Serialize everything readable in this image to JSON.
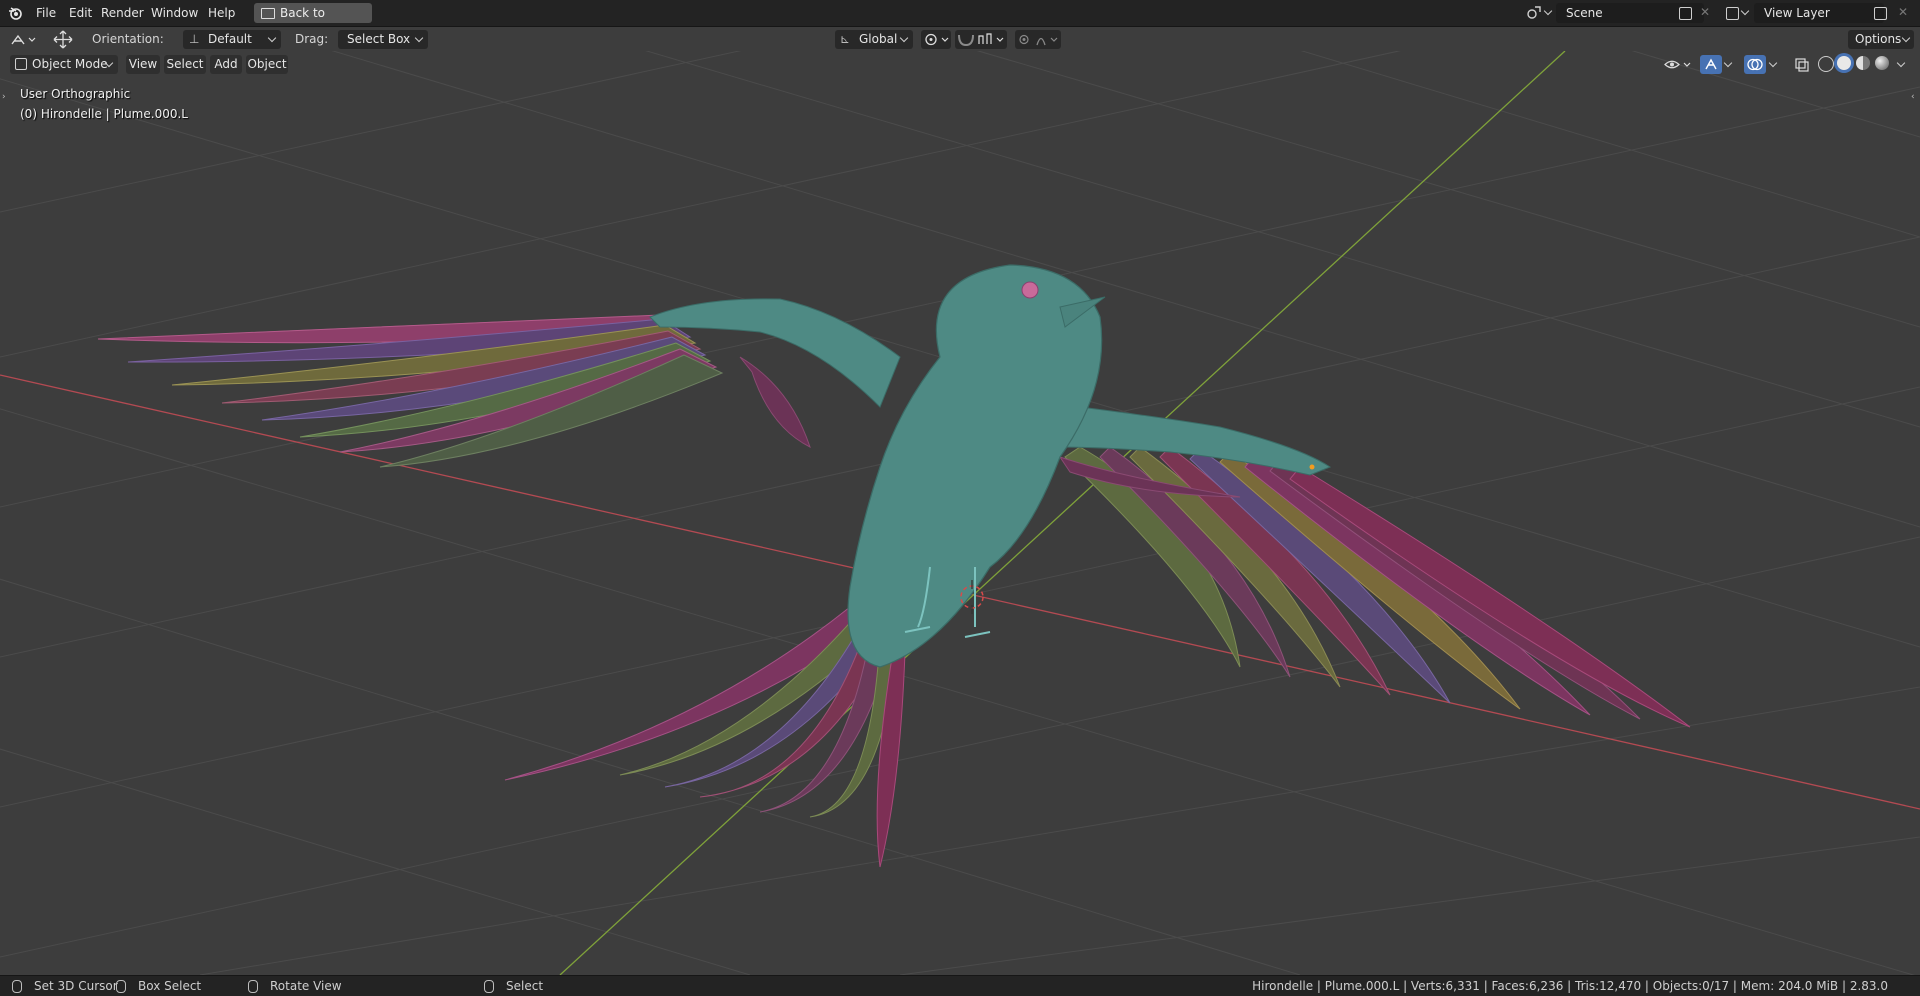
{
  "topbar": {
    "menus": [
      "File",
      "Edit",
      "Render",
      "Window",
      "Help"
    ],
    "back_label": "Back to Previous",
    "scene_name": "Scene",
    "view_layer_name": "View Layer"
  },
  "toolbar": {
    "orientation_label": "Orientation:",
    "orientation_value": "Default",
    "drag_label": "Drag:",
    "drag_value": "Select Box",
    "transform_orientation": "Global",
    "options_label": "Options"
  },
  "header": {
    "mode": "Object Mode",
    "menus": [
      "View",
      "Select",
      "Add",
      "Object"
    ]
  },
  "viewport": {
    "view_name": "User Orthographic",
    "object_info": "(0) Hirondelle | Plume.000.L",
    "colors": {
      "background": "#3d3d3d",
      "grid": "#4a4a4a",
      "x_axis": "#b34a52",
      "y_axis": "#7fa23a",
      "body": "#4e8a84"
    }
  },
  "statusbar": {
    "hint1": "Set 3D Cursor",
    "hint2": "Box Select",
    "hint3": "Rotate View",
    "hint4": "Select",
    "stats": "Hirondelle | Plume.000.L | Verts:6,331 | Faces:6,236 | Tris:12,470 | Objects:0/17 | Mem: 204.0 MiB | 2.83.0"
  }
}
